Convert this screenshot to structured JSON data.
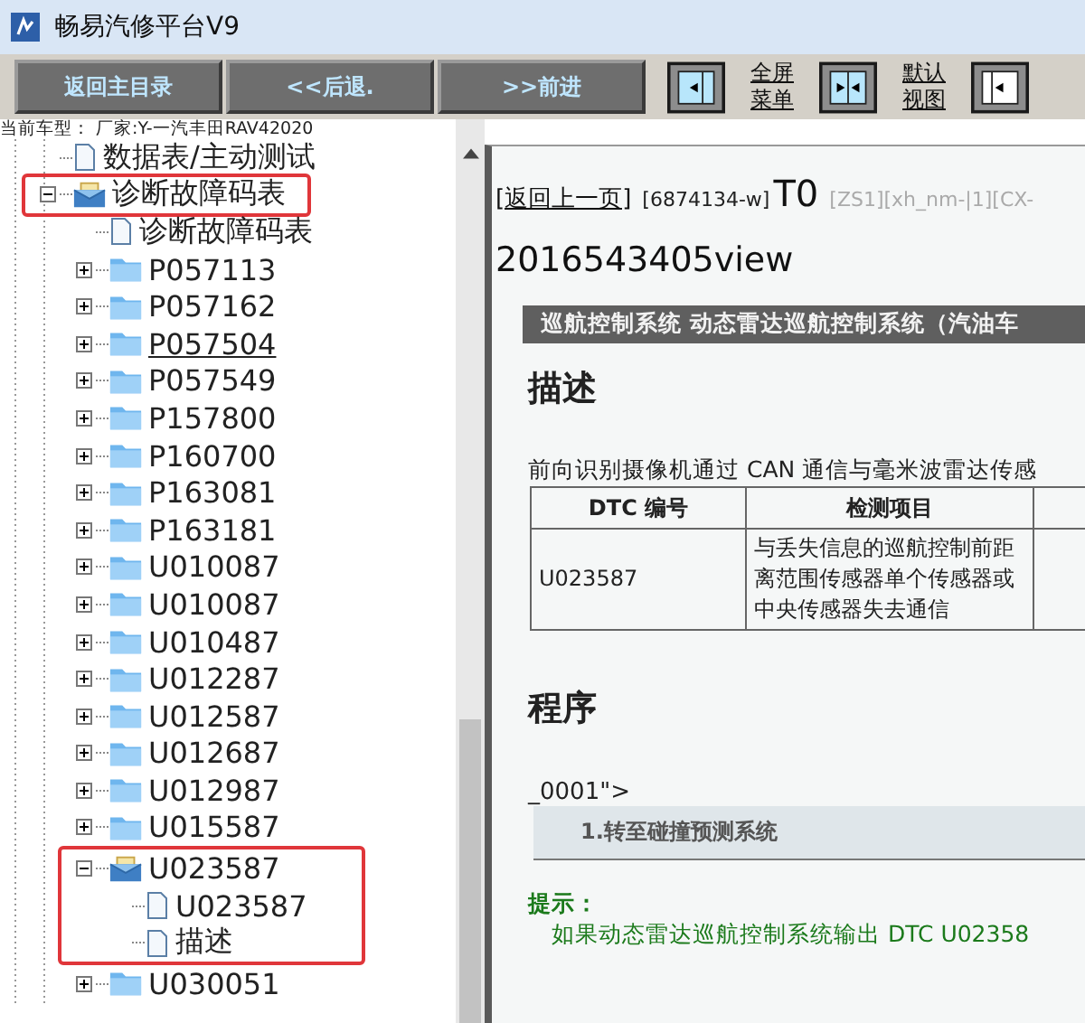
{
  "window": {
    "title": "畅易汽修平台V9"
  },
  "toolbar": {
    "buttons": [
      "返回主目录",
      "<<后退.",
      ">>前进"
    ],
    "view_controls": [
      {
        "kind": "pane",
        "label": [
          "全屏",
          "菜单"
        ]
      },
      {
        "kind": "split",
        "label": [
          "默认",
          "视图"
        ]
      },
      {
        "kind": "left"
      }
    ]
  },
  "vehicle": "当前车型：  厂家:Y-一汽丰田RAV42020",
  "tree": [
    {
      "label": "数据表/主动测试",
      "kind": "doc"
    },
    {
      "label": "诊断故障码表",
      "kind": "folder",
      "expanded": true,
      "highlighted": true,
      "children": [
        {
          "label": "诊断故障码表",
          "kind": "doc"
        },
        {
          "label": "P057113",
          "kind": "folder",
          "expanded": false
        },
        {
          "label": "P057162",
          "kind": "folder",
          "expanded": false
        },
        {
          "label": "P057504",
          "kind": "folder",
          "expanded": false,
          "hovered": true
        },
        {
          "label": "P057549",
          "kind": "folder",
          "expanded": false
        },
        {
          "label": "P157800",
          "kind": "folder",
          "expanded": false
        },
        {
          "label": "P160700",
          "kind": "folder",
          "expanded": false
        },
        {
          "label": "P163081",
          "kind": "folder",
          "expanded": false
        },
        {
          "label": "P163181",
          "kind": "folder",
          "expanded": false
        },
        {
          "label": "U010087",
          "kind": "folder",
          "expanded": false
        },
        {
          "label": "U010087",
          "kind": "folder",
          "expanded": false
        },
        {
          "label": "U010487",
          "kind": "folder",
          "expanded": false
        },
        {
          "label": "U012287",
          "kind": "folder",
          "expanded": false
        },
        {
          "label": "U012587",
          "kind": "folder",
          "expanded": false
        },
        {
          "label": "U012687",
          "kind": "folder",
          "expanded": false
        },
        {
          "label": "U012987",
          "kind": "folder",
          "expanded": false
        },
        {
          "label": "U015587",
          "kind": "folder",
          "expanded": false
        },
        {
          "label": "U023587",
          "kind": "folder",
          "expanded": true,
          "highlighted": true,
          "children": [
            {
              "label": "U023587",
              "kind": "doc",
              "highlighted": true
            },
            {
              "label": "描述",
              "kind": "doc",
              "highlighted": true
            }
          ]
        },
        {
          "label": "U030051",
          "kind": "folder",
          "expanded": false
        }
      ]
    }
  ],
  "content": {
    "back_link": "[返回上一页]",
    "doc_id": "[6874134-w]",
    "code": "T0",
    "tags": "[ZS1][xh_nm-|1][CX-",
    "view_title": "2016543405view",
    "section_bar": "巡航控制系统  动态雷达巡航控制系统（汽油车",
    "heading_description": "描述",
    "paragraph": "前向识别摄像机通过 CAN 通信与毫米波雷达传感",
    "table": {
      "columns": [
        "DTC 编号",
        "检测项目"
      ],
      "rows": [
        [
          "U023587",
          "与丢失信息的巡航控制前距离范围传感器单个传感器或中央传感器失去通信"
        ]
      ]
    },
    "heading_procedure": "程序",
    "fragment": "_0001\">",
    "step": "1.转至碰撞预测系统",
    "hint_title": "提示：",
    "hint_text": "如果动态雷达巡航控制系统输出 DTC U02358"
  }
}
